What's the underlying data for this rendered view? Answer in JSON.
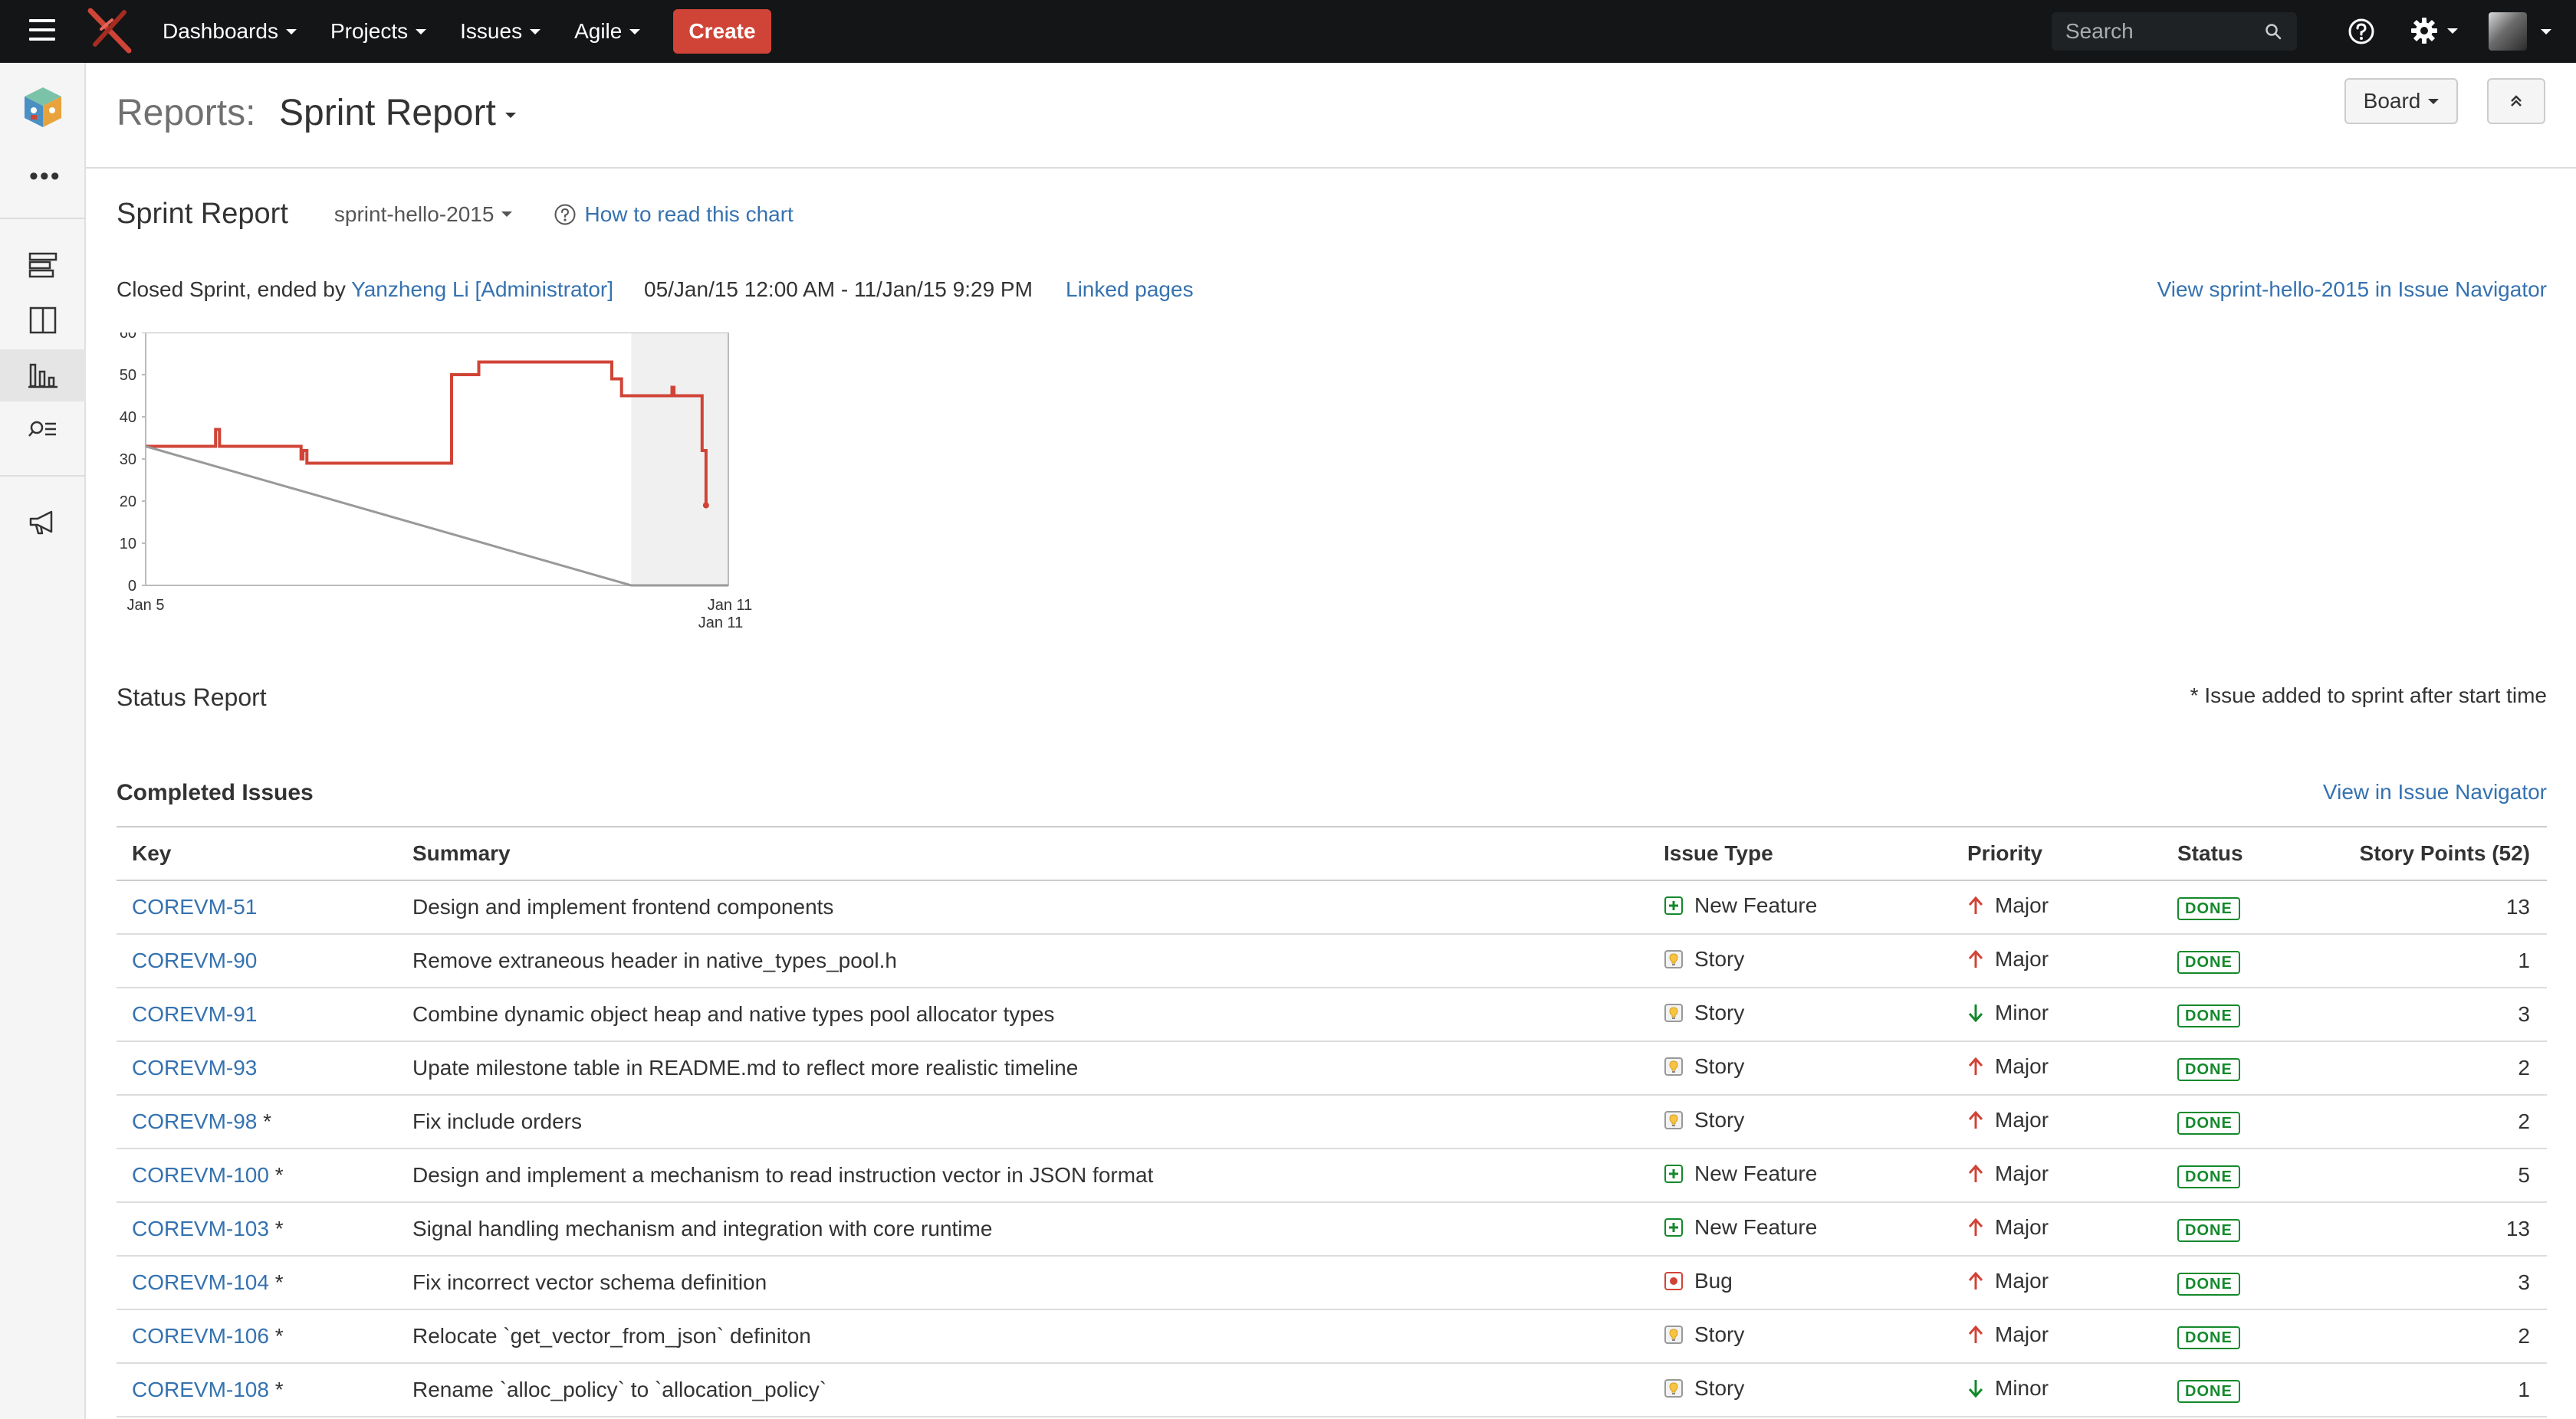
{
  "topbar": {
    "nav": [
      "Dashboards",
      "Projects",
      "Issues",
      "Agile"
    ],
    "create_label": "Create",
    "search_placeholder": "Search"
  },
  "header": {
    "prefix": "Reports:",
    "title": "Sprint Report",
    "board_label": "Board"
  },
  "report": {
    "title": "Sprint Report",
    "sprint_name": "sprint-hello-2015",
    "help_link": "How to read this chart",
    "closed_text": "Closed Sprint, ended by ",
    "ended_by": "Yanzheng Li [Administrator]",
    "dates": "05/Jan/15 12:00 AM - 11/Jan/15 9:29 PM",
    "linked_pages": "Linked pages",
    "view_sprint_link": "View sprint-hello-2015 in Issue Navigator"
  },
  "chart_data": {
    "type": "line",
    "title": "",
    "xlabel": "",
    "ylabel": "",
    "ylim": [
      0,
      60
    ],
    "yticks": [
      0,
      10,
      20,
      30,
      40,
      50,
      60
    ],
    "x_tick_labels": [
      "Jan 5",
      "Jan 11"
    ],
    "x_tick_label_extra": "Jan 11",
    "non_working_band": [
      5.0,
      6.0
    ],
    "series": [
      {
        "color": "#d04437",
        "step": true,
        "points": [
          [
            0,
            33
          ],
          [
            0.72,
            33
          ],
          [
            0.72,
            37
          ],
          [
            0.76,
            37
          ],
          [
            0.76,
            33
          ],
          [
            1.6,
            33
          ],
          [
            1.6,
            30
          ],
          [
            1.62,
            30
          ],
          [
            1.62,
            32
          ],
          [
            1.66,
            32
          ],
          [
            1.66,
            29
          ],
          [
            3.15,
            29
          ],
          [
            3.15,
            50
          ],
          [
            3.43,
            50
          ],
          [
            3.43,
            53
          ],
          [
            4.8,
            53
          ],
          [
            4.8,
            49
          ],
          [
            4.9,
            49
          ],
          [
            4.9,
            45
          ],
          [
            5.42,
            45
          ],
          [
            5.42,
            47
          ],
          [
            5.44,
            47
          ],
          [
            5.44,
            45
          ],
          [
            5.73,
            45
          ],
          [
            5.73,
            32
          ],
          [
            5.77,
            32
          ],
          [
            5.77,
            19
          ]
        ]
      },
      {
        "color": "#999999",
        "step": false,
        "points": [
          [
            0,
            33
          ],
          [
            5.0,
            0
          ],
          [
            6.0,
            0
          ]
        ]
      }
    ]
  },
  "status": {
    "title": "Status Report",
    "note": "* Issue added to sprint after start time"
  },
  "completed": {
    "title": "Completed Issues",
    "view_link": "View in Issue Navigator",
    "columns": [
      "Key",
      "Summary",
      "Issue Type",
      "Priority",
      "Status",
      "Story Points (52)"
    ],
    "rows": [
      {
        "key": "COREVM-51",
        "added": "",
        "summary": "Design and implement frontend components",
        "type": "New Feature",
        "type_icon": "new-feature-icon",
        "priority": "Major",
        "priority_icon": "major-priority-icon",
        "status": "DONE",
        "points": "13"
      },
      {
        "key": "COREVM-90",
        "added": "",
        "summary": "Remove extraneous header in native_types_pool.h",
        "type": "Story",
        "type_icon": "story-icon",
        "priority": "Major",
        "priority_icon": "major-priority-icon",
        "status": "DONE",
        "points": "1"
      },
      {
        "key": "COREVM-91",
        "added": "",
        "summary": "Combine dynamic object heap and native types pool allocator types",
        "type": "Story",
        "type_icon": "story-icon",
        "priority": "Minor",
        "priority_icon": "minor-priority-icon",
        "status": "DONE",
        "points": "3"
      },
      {
        "key": "COREVM-93",
        "added": "",
        "summary": "Upate milestone table in README.md to reflect more realistic timeline",
        "type": "Story",
        "type_icon": "story-icon",
        "priority": "Major",
        "priority_icon": "major-priority-icon",
        "status": "DONE",
        "points": "2"
      },
      {
        "key": "COREVM-98",
        "added": " *",
        "summary": "Fix include orders",
        "type": "Story",
        "type_icon": "story-icon",
        "priority": "Major",
        "priority_icon": "major-priority-icon",
        "status": "DONE",
        "points": "2"
      },
      {
        "key": "COREVM-100",
        "added": " *",
        "summary": "Design and implement a mechanism to read instruction vector in JSON format",
        "type": "New Feature",
        "type_icon": "new-feature-icon",
        "priority": "Major",
        "priority_icon": "major-priority-icon",
        "status": "DONE",
        "points": "5"
      },
      {
        "key": "COREVM-103",
        "added": " *",
        "summary": "Signal handling mechanism and integration with core runtime",
        "type": "New Feature",
        "type_icon": "new-feature-icon",
        "priority": "Major",
        "priority_icon": "major-priority-icon",
        "status": "DONE",
        "points": "13"
      },
      {
        "key": "COREVM-104",
        "added": " *",
        "summary": "Fix incorrect vector schema definition",
        "type": "Bug",
        "type_icon": "bug-icon",
        "priority": "Major",
        "priority_icon": "major-priority-icon",
        "status": "DONE",
        "points": "3"
      },
      {
        "key": "COREVM-106",
        "added": " *",
        "summary": "Relocate `get_vector_from_json` definiton",
        "type": "Story",
        "type_icon": "story-icon",
        "priority": "Major",
        "priority_icon": "major-priority-icon",
        "status": "DONE",
        "points": "2"
      },
      {
        "key": "COREVM-108",
        "added": " *",
        "summary": "Rename `alloc_policy` to `allocation_policy`",
        "type": "Story",
        "type_icon": "story-icon",
        "priority": "Minor",
        "priority_icon": "minor-priority-icon",
        "status": "DONE",
        "points": "1"
      }
    ]
  },
  "colors": {
    "topbar": "#131516",
    "create": "#d04437",
    "link": "#3572b0",
    "done": "#14892c",
    "burndown": "#d04437",
    "guideline": "#999999"
  }
}
